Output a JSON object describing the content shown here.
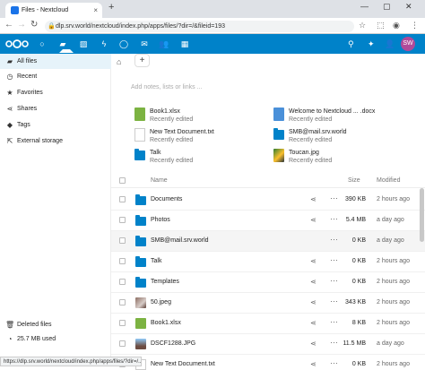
{
  "browser": {
    "tab_title": "Files - Nextcloud",
    "tab_close": "×",
    "new_tab": "+",
    "url": "dlp.srv.world/nextcloud/index.php/apps/files/?dir=/&fileid=193",
    "status_url": "https://dlp.srv.world/nextcloud/index.php/apps/files/?dir=/..."
  },
  "header": {
    "avatar_initials": "SW",
    "brand_color": "#0082c9"
  },
  "sidebar": {
    "items": [
      {
        "label": "All files",
        "icon": "folder-icon"
      },
      {
        "label": "Recent",
        "icon": "clock-icon"
      },
      {
        "label": "Favorites",
        "icon": "star-icon"
      },
      {
        "label": "Shares",
        "icon": "share-icon"
      },
      {
        "label": "Tags",
        "icon": "tag-icon"
      },
      {
        "label": "External storage",
        "icon": "external-link-icon"
      }
    ],
    "bottom": [
      {
        "label": "Deleted files",
        "icon": "trash-icon"
      },
      {
        "label": "25.7 MB used",
        "icon": "pie-icon"
      }
    ]
  },
  "main": {
    "notes_placeholder": "Add notes, lists or links ...",
    "recent": [
      {
        "name": "Book1.xlsx",
        "sub": "Recently edited",
        "icon": "spreadsheet-icon"
      },
      {
        "name": "Welcome to Nextcloud ... .docx",
        "sub": "Recently edited",
        "icon": "document-icon"
      },
      {
        "name": "New Text Document.txt",
        "sub": "Recently edited",
        "icon": "text-file-icon"
      },
      {
        "name": "SMB@mail.srv.world",
        "sub": "Recently edited",
        "icon": "folder-icon"
      },
      {
        "name": "Talk",
        "sub": "Recently edited",
        "icon": "folder-icon"
      },
      {
        "name": "Toucan.jpg",
        "sub": "Recently edited",
        "icon": "image-thumbnail-icon"
      }
    ],
    "columns": {
      "name": "Name",
      "size": "Size",
      "modified": "Modified"
    },
    "files": [
      {
        "name": "Documents",
        "size": "390 KB",
        "modified": "2 hours ago",
        "type": "folder"
      },
      {
        "name": "Photos",
        "size": "5.4 MB",
        "modified": "a day ago",
        "type": "folder"
      },
      {
        "name": "SMB@mail.srv.world",
        "size": "0 KB",
        "modified": "a day ago",
        "type": "external-folder"
      },
      {
        "name": "Talk",
        "size": "0 KB",
        "modified": "2 hours ago",
        "type": "folder"
      },
      {
        "name": "Templates",
        "size": "0 KB",
        "modified": "2 hours ago",
        "type": "folder"
      },
      {
        "name": "50.jpeg",
        "size": "343 KB",
        "modified": "2 hours ago",
        "type": "image"
      },
      {
        "name": "Book1.xlsx",
        "size": "8 KB",
        "modified": "2 hours ago",
        "type": "spreadsheet"
      },
      {
        "name": "DSCF1288.JPG",
        "size": "11.5 MB",
        "modified": "a day ago",
        "type": "image"
      },
      {
        "name": "New Text Document.txt",
        "size": "0 KB",
        "modified": "2 hours ago",
        "type": "text"
      }
    ]
  }
}
